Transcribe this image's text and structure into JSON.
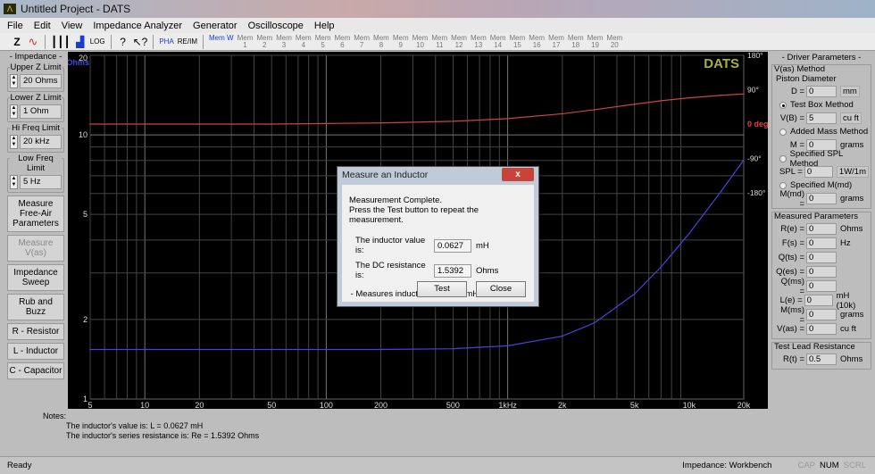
{
  "window": {
    "title": "Untitled Project - DATS"
  },
  "menu": [
    "File",
    "Edit",
    "View",
    "Impedance Analyzer",
    "Generator",
    "Oscilloscope",
    "Help"
  ],
  "toolbar": {
    "z": "Z",
    "mem_w": "Mem W",
    "log": "LOG",
    "pha": "PHA",
    "re_im": "RE/IM",
    "icons": [
      "impedance-icon",
      "sine-wave-icon",
      "bars-icon",
      "bar-chart-icon",
      "log-icon",
      "help-icon",
      "context-help-icon",
      "phase-icon",
      "re-im-icon",
      "mem-w-icon"
    ]
  },
  "left": {
    "title": "- Impedance -",
    "limits": [
      {
        "label": "Upper Z Limit",
        "value": "20 Ohms"
      },
      {
        "label": "Lower Z Limit",
        "value": "1 Ohm"
      },
      {
        "label": "Hi Freq Limit",
        "value": "20 kHz"
      },
      {
        "label": "Low Freq Limit",
        "value": "5 Hz"
      }
    ],
    "buttons": [
      {
        "label": "Measure Free-Air Parameters",
        "disabled": false
      },
      {
        "label": "Measure V(as)",
        "disabled": true
      },
      {
        "label": "Impedance Sweep",
        "disabled": false
      },
      {
        "label": "Rub and Buzz",
        "disabled": false
      },
      {
        "label": "R - Resistor",
        "disabled": false
      },
      {
        "label": "L - Inductor",
        "disabled": false
      },
      {
        "label": "C - Capacitor",
        "disabled": false
      }
    ]
  },
  "chart_data": {
    "type": "line",
    "brand": "DATS",
    "xscale": "log",
    "xlim": [
      5,
      20000
    ],
    "xticks": [
      "5",
      "10",
      "20",
      "50",
      "100",
      "200",
      "500",
      "1kHz",
      "2k",
      "5k",
      "10k",
      "20k"
    ],
    "xtick_values": [
      5,
      10,
      20,
      50,
      100,
      200,
      500,
      1000,
      2000,
      5000,
      10000,
      20000
    ],
    "y_left": {
      "label": "Ohms",
      "scale": "log",
      "lim": [
        1,
        20
      ],
      "ticks": [
        "20",
        "10",
        "5",
        "2",
        "1"
      ],
      "tick_values": [
        20,
        10,
        5,
        2,
        1
      ]
    },
    "y_right": {
      "label": "0 deg",
      "lim": [
        -180,
        180
      ],
      "ticks": [
        "180°",
        "90°",
        "-90°",
        "-180°"
      ],
      "tick_values": [
        180,
        90,
        -90,
        -180
      ]
    },
    "grid": true,
    "x": [
      5,
      10,
      20,
      50,
      100,
      200,
      500,
      1000,
      2000,
      3000,
      5000,
      7000,
      10000,
      15000,
      20000
    ],
    "series": [
      {
        "color": "#4444dd",
        "values": [
          1.54,
          1.54,
          1.54,
          1.54,
          1.54,
          1.54,
          1.55,
          1.59,
          1.73,
          1.94,
          2.5,
          3.16,
          4.23,
          6.11,
          8.03
        ]
      },
      {
        "color": "#cc4444",
        "values": [
          0,
          0,
          0,
          0,
          1.5,
          2.9,
          7.3,
          14.4,
          27,
          37.5,
          52,
          61,
          68.7,
          75.4,
          78.9
        ]
      }
    ],
    "colors": {
      "background": "#000000",
      "grid": "#555555",
      "dats": "#a8b040"
    }
  },
  "right": {
    "title": "- Driver Parameters -",
    "vas_method": "V(as) Method",
    "piston": "Piston Diameter",
    "D": {
      "k": "D =",
      "v": "0",
      "u": "mm"
    },
    "test_box": "Test Box Method",
    "VB": {
      "k": "V(B) =",
      "v": "5",
      "u": "cu ft"
    },
    "added_mass": "Added Mass Method",
    "M": {
      "k": "M =",
      "v": "0",
      "u": "grams"
    },
    "spl_method": "Specified SPL Method",
    "SPL": {
      "k": "SPL =",
      "v": "0",
      "u": "1W/1m"
    },
    "mmd_method": "Specified M(md)",
    "MMD": {
      "k": "M(md) =",
      "v": "0",
      "u": "grams"
    },
    "measured_title": "Measured Parameters",
    "measured": [
      {
        "k": "R(e) =",
        "v": "0",
        "u": "Ohms"
      },
      {
        "k": "F(s) =",
        "v": "0",
        "u": "Hz"
      },
      {
        "k": "Q(ts) =",
        "v": "0",
        "u": ""
      },
      {
        "k": "Q(es) =",
        "v": "0",
        "u": ""
      },
      {
        "k": "Q(ms) =",
        "v": "0",
        "u": ""
      },
      {
        "k": "L(e) =",
        "v": "0",
        "u": "mH (10k)"
      },
      {
        "k": "M(ms) =",
        "v": "0",
        "u": "grams"
      },
      {
        "k": "V(as) =",
        "v": "0",
        "u": "cu ft"
      }
    ],
    "lead_title": "Test Lead Resistance",
    "RT": {
      "k": "R(t) =",
      "v": "0.5",
      "u": "Ohms"
    }
  },
  "notes": {
    "label": "Notes:",
    "lines": [
      "The inductor's value is:   L = 0.0627 mH",
      "The inductor's series resistance is:   Re = 1.5392 Ohms"
    ]
  },
  "status": {
    "left": "Ready",
    "mode": "Impedance: Workbench",
    "cap": "CAP",
    "num": "NUM",
    "scrl": "SCRL"
  },
  "dialog": {
    "title": "Measure an Inductor",
    "close": "x",
    "msg1": "Measurement Complete.",
    "msg2": "Press the Test button to repeat the measurement.",
    "ind_label": "The inductor value is:",
    "ind_value": "0.0627",
    "ind_unit": "mH",
    "dc_label": "The DC resistance is:",
    "dc_value": "1.5392",
    "dc_unit": "Ohms",
    "range": "- Measures inductors from .05 mH to 100 mH -",
    "test": "Test",
    "close_btn": "Close"
  }
}
